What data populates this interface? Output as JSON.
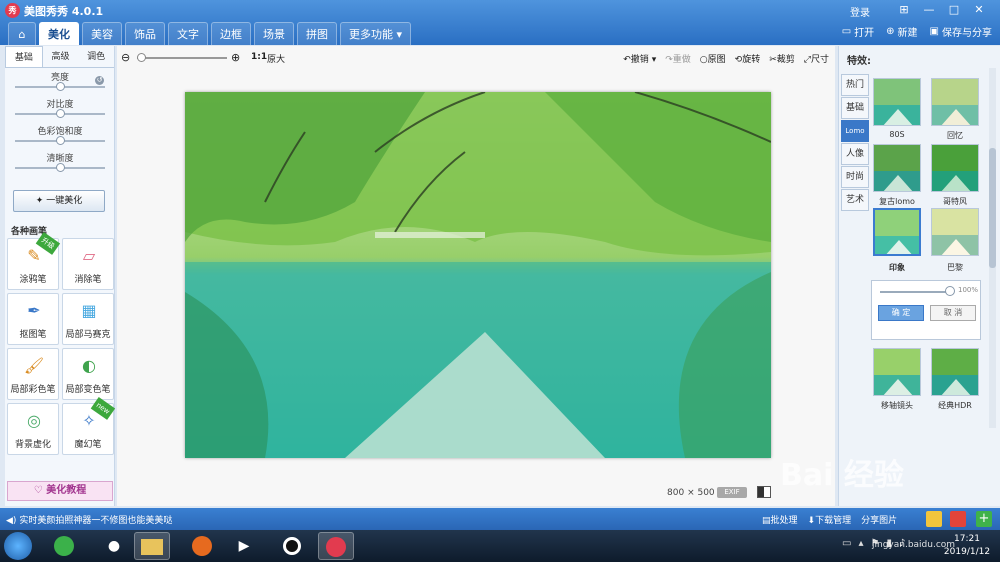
{
  "window": {
    "title": "美图秀秀 4.0.1",
    "logo_text": "秀",
    "login": "登录",
    "controls": [
      "⊞",
      "—",
      "□",
      "✕"
    ]
  },
  "nav": {
    "tabs": [
      "美化",
      "美容",
      "饰品",
      "文字",
      "边框",
      "场景",
      "拼图",
      "更多功能"
    ],
    "active": "美化"
  },
  "actions": {
    "open": "打开",
    "new": "新建",
    "save_share": "保存与分享"
  },
  "left_panel": {
    "subtabs": [
      "基础",
      "高级",
      "调色"
    ],
    "sliders": [
      {
        "label": "亮度",
        "value": 0.5
      },
      {
        "label": "对比度",
        "value": 0.5
      },
      {
        "label": "色彩饱和度",
        "value": 0.5
      },
      {
        "label": "清晰度",
        "value": 0.5
      }
    ],
    "one_click_button": "一键美化",
    "brushes_title": "各种画笔",
    "tools": [
      {
        "label": "涂鸦笔",
        "badge": "升级"
      },
      {
        "label": "消除笔",
        "badge": ""
      },
      {
        "label": "抠图笔",
        "badge": ""
      },
      {
        "label": "局部马赛克",
        "badge": ""
      },
      {
        "label": "局部彩色笔",
        "badge": ""
      },
      {
        "label": "局部变色笔",
        "badge": ""
      },
      {
        "label": "背景虚化",
        "badge": ""
      },
      {
        "label": "魔幻笔",
        "badge": "new"
      }
    ],
    "tutorial": "美化教程"
  },
  "canvas_toolbar": {
    "one_to_one": "1:1",
    "original_size": "原大",
    "undo": "撤销",
    "redo": "重做",
    "original": "原图",
    "rotate": "旋转",
    "crop": "裁剪",
    "resize": "尺寸",
    "zoom": 0.0
  },
  "canvas_status": {
    "width": "800",
    "times": "×",
    "height": "500",
    "exif": "EXIF"
  },
  "right_panel": {
    "title": "特效:",
    "categories": [
      "热门",
      "基础",
      "Lomo",
      "人像",
      "时尚",
      "艺术"
    ],
    "active_category": "Lomo",
    "effects": [
      {
        "label": "80S"
      },
      {
        "label": "回忆"
      },
      {
        "label": "复古lomo"
      },
      {
        "label": "哥特风"
      },
      {
        "label": "印象",
        "selected": true
      },
      {
        "label": "巴黎"
      },
      {
        "label": "移轴镜头"
      },
      {
        "label": "经典HDR"
      }
    ],
    "intensity": {
      "value_text": "100%",
      "fraction": 1.0
    },
    "ok": "确 定",
    "cancel": "取 消"
  },
  "statusbar": {
    "message": "实时美颜拍照神器一不修图也能美美哒",
    "batch": "批处理",
    "download_manager": "下载管理",
    "share_image": "分享图片"
  },
  "taskbar": {
    "time": "17:21",
    "date": "2019/1/12"
  },
  "watermark": {
    "text": "Bai 经验",
    "url": "jingyan.baidu.com"
  },
  "colors": {
    "title_blue": "#2a6fc3",
    "active_cat": "#3a78c8",
    "status_blue": "#2a66b5"
  }
}
